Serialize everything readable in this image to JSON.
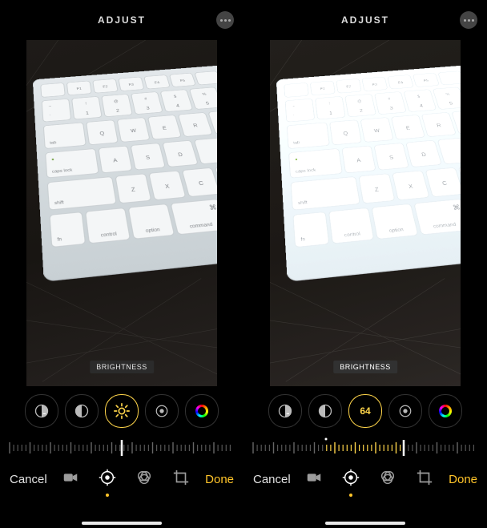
{
  "topbar": {
    "title": "ADJUST"
  },
  "chip": {
    "label": "BRIGHTNESS"
  },
  "tool_names": [
    "exposure",
    "contrast",
    "brightness",
    "highlights",
    "color"
  ],
  "brightness_value": "64",
  "bottom": {
    "cancel": "Cancel",
    "done": "Done",
    "icons": [
      "video",
      "live",
      "adjust",
      "filters",
      "crop"
    ]
  },
  "keyboard": {
    "topRow": [
      "F1",
      "F2",
      "F3",
      "F4",
      "F5"
    ],
    "numRow": [
      "1",
      "2",
      "3",
      "4",
      "5"
    ],
    "letters1": [
      "Q",
      "W",
      "E",
      "R"
    ],
    "letters2": [
      "A",
      "S",
      "D"
    ],
    "letters3": [
      "Z",
      "X",
      "C"
    ],
    "modRow": [
      "fn",
      "control",
      "option",
      "command"
    ],
    "tab": "tab",
    "caps": "caps lock",
    "shift": "shift",
    "tilde": "~",
    "backtick": "`",
    "cmdglyph": "⌘",
    "escglyph": "⎋"
  }
}
